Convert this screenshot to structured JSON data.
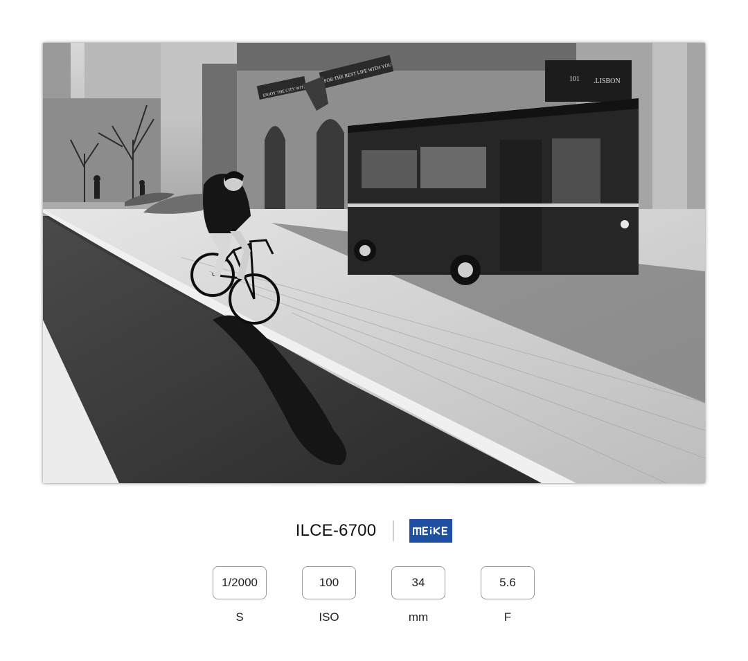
{
  "photo": {
    "signs": {
      "banner_left": "ENJOY THE CITY WITH YOU",
      "banner_right": "FOR THE REST LIFE WITH YOU",
      "tram_number": "101",
      "tram_destination": ".LISBON"
    }
  },
  "camera": {
    "model": "ILCE-6700",
    "brand_logo_text": "MEIKE",
    "brand_color": "#1f4fa3"
  },
  "exif": [
    {
      "value": "1/2000",
      "label": "S"
    },
    {
      "value": "100",
      "label": "ISO"
    },
    {
      "value": "34",
      "label": "mm"
    },
    {
      "value": "5.6",
      "label": "F"
    }
  ]
}
